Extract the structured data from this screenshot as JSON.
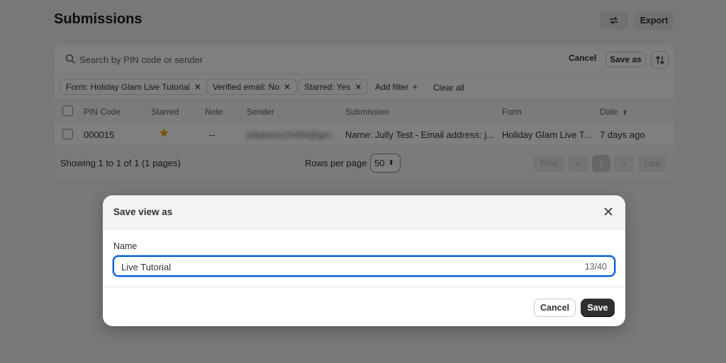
{
  "page": {
    "title": "Submissions",
    "export_label": "Export",
    "sync_icon": "sync-icon"
  },
  "search": {
    "placeholder": "Search by PIN code or sender",
    "cancel_label": "Cancel",
    "save_as_label": "Save as",
    "sort_icon": "sort-icon"
  },
  "filters": {
    "chips": [
      "Form: Holiday Glam Live Tutorial",
      "Verified email: No",
      "Starred: Yes"
    ],
    "add_filter_label": "Add filter",
    "clear_all_label": "Clear all"
  },
  "table": {
    "headers": [
      "PIN Code",
      "Starred",
      "Note",
      "Sender",
      "Submission",
      "Form",
      "Date"
    ],
    "rows": [
      {
        "pin": "000015",
        "starred": true,
        "note": "--",
        "sender": "jullytest123456@gm...",
        "submission": "Name: Jully Test - Email address: j...",
        "form": "Holiday Glam Live T...",
        "date": "7 days ago"
      }
    ]
  },
  "footer": {
    "showing": "Showing 1 to 1 of 1 (1 pages)",
    "rows_per_page_label": "Rows per page",
    "rows_per_page_value": "50",
    "first_label": "First",
    "prev_label": "<",
    "current_page": "1",
    "next_label": ">",
    "last_label": "Last"
  },
  "modal": {
    "title": "Save view as",
    "name_label": "Name",
    "name_value": "Live Tutorial",
    "char_count": "13/40",
    "cancel_label": "Cancel",
    "save_label": "Save"
  },
  "colors": {
    "primary_button": "#303030",
    "focus_ring": "#005bd3",
    "star": "#e8a400",
    "overlay": "rgba(0,0,0,0.5)"
  }
}
